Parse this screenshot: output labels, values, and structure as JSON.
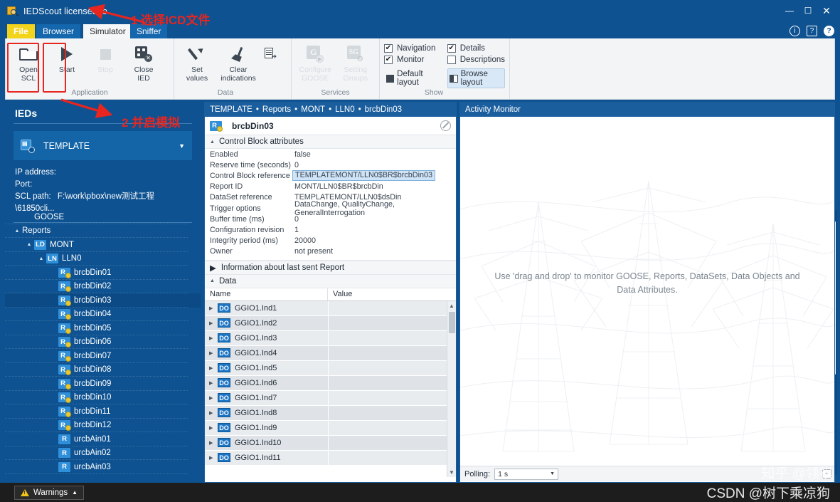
{
  "window": {
    "title": "IEDScout licensed to",
    "app_icon": "magnifier-icon",
    "minimize": "—",
    "maximize": "☐",
    "close": "✕"
  },
  "help_icons": [
    {
      "name": "info-icon",
      "glyph": "i"
    },
    {
      "name": "feedback-icon",
      "glyph": "?"
    },
    {
      "name": "help-icon",
      "glyph": "?"
    }
  ],
  "tabs": [
    {
      "label": "File",
      "name": "tab-file",
      "state": "file"
    },
    {
      "label": "Browser",
      "name": "tab-browser",
      "state": "normal"
    },
    {
      "label": "Simulator",
      "name": "tab-simulator",
      "state": "active"
    },
    {
      "label": "Sniffer",
      "name": "tab-sniffer",
      "state": "normal"
    }
  ],
  "ribbon": {
    "groups": [
      {
        "label": "Application",
        "buttons": [
          {
            "label": "Open\nSCL",
            "icon": "folder-open-icon",
            "disabled": false
          },
          {
            "label": "Start",
            "icon": "play-icon",
            "disabled": false
          },
          {
            "label": "Stop",
            "icon": "stop-icon",
            "disabled": true
          },
          {
            "label": "Close\nIED",
            "icon": "close-ied-icon",
            "disabled": false
          }
        ]
      },
      {
        "label": "Data",
        "buttons": [
          {
            "label": "Set\nvalues",
            "icon": "pencil-icon",
            "disabled": false
          },
          {
            "label": "Clear\nindications",
            "icon": "broom-icon",
            "disabled": false
          },
          {
            "label": "",
            "icon": "report-export-icon",
            "disabled": false
          }
        ]
      },
      {
        "label": "Services",
        "buttons": [
          {
            "label": "Configure\nGOOSE",
            "icon": "goose-config-icon",
            "disabled": true
          },
          {
            "label": "Setting\nGroups",
            "icon": "setting-groups-icon",
            "disabled": true
          }
        ]
      }
    ],
    "show_group": {
      "label": "Show",
      "checkboxes": [
        {
          "label": "Navigation",
          "checked": true
        },
        {
          "label": "Details",
          "checked": true
        },
        {
          "label": "Monitor",
          "checked": true
        },
        {
          "label": "Descriptions",
          "checked": false
        }
      ],
      "layouts": [
        {
          "label": "Default layout",
          "selected": false
        },
        {
          "label": "Browse layout",
          "selected": true
        }
      ]
    }
  },
  "sidebar": {
    "title": "IEDs",
    "ied": {
      "name": "TEMPLATE",
      "icon": "ied-icon",
      "caret": "▼"
    },
    "meta": [
      {
        "key": "IP address:",
        "value": ""
      },
      {
        "key": "Port:",
        "value": ""
      },
      {
        "key": "SCL path:",
        "value": "F:\\work\\pbox\\new测试工程\\61850cli..."
      }
    ],
    "tree": [
      {
        "label": "GOOSE",
        "indent": 1,
        "twist": "",
        "badge": "",
        "selected": false
      },
      {
        "label": "Reports",
        "indent": 0,
        "twist": "▲",
        "badge": "",
        "selected": false
      },
      {
        "label": "MONT",
        "indent": 1,
        "twist": "▲",
        "badge": "LD",
        "selected": false
      },
      {
        "label": "LLN0",
        "indent": 2,
        "twist": "▲",
        "badge": "LN",
        "selected": false
      },
      {
        "label": "brcbDin01",
        "indent": 3,
        "twist": "",
        "badge": "R",
        "badge_dot": true,
        "selected": false
      },
      {
        "label": "brcbDin02",
        "indent": 3,
        "twist": "",
        "badge": "R",
        "badge_dot": true,
        "selected": false
      },
      {
        "label": "brcbDin03",
        "indent": 3,
        "twist": "",
        "badge": "R",
        "badge_dot": true,
        "selected": true
      },
      {
        "label": "brcbDin04",
        "indent": 3,
        "twist": "",
        "badge": "R",
        "badge_dot": true,
        "selected": false
      },
      {
        "label": "brcbDin05",
        "indent": 3,
        "twist": "",
        "badge": "R",
        "badge_dot": true,
        "selected": false
      },
      {
        "label": "brcbDin06",
        "indent": 3,
        "twist": "",
        "badge": "R",
        "badge_dot": true,
        "selected": false
      },
      {
        "label": "brcbDin07",
        "indent": 3,
        "twist": "",
        "badge": "R",
        "badge_dot": true,
        "selected": false
      },
      {
        "label": "brcbDin08",
        "indent": 3,
        "twist": "",
        "badge": "R",
        "badge_dot": true,
        "selected": false
      },
      {
        "label": "brcbDin09",
        "indent": 3,
        "twist": "",
        "badge": "R",
        "badge_dot": true,
        "selected": false
      },
      {
        "label": "brcbDin10",
        "indent": 3,
        "twist": "",
        "badge": "R",
        "badge_dot": true,
        "selected": false
      },
      {
        "label": "brcbDin11",
        "indent": 3,
        "twist": "",
        "badge": "R",
        "badge_dot": true,
        "selected": false
      },
      {
        "label": "brcbDin12",
        "indent": 3,
        "twist": "",
        "badge": "R",
        "badge_dot": true,
        "selected": false
      },
      {
        "label": "urcbAin01",
        "indent": 3,
        "twist": "",
        "badge": "R",
        "badge_dot": false,
        "selected": false
      },
      {
        "label": "urcbAin02",
        "indent": 3,
        "twist": "",
        "badge": "R",
        "badge_dot": false,
        "selected": false
      },
      {
        "label": "urcbAin03",
        "indent": 3,
        "twist": "",
        "badge": "R",
        "badge_dot": false,
        "selected": false
      }
    ],
    "scroll_up": "▲",
    "scroll_down": "▼"
  },
  "details": {
    "breadcrumb": [
      "TEMPLATE",
      "Reports",
      "MONT",
      "LLN0",
      "brcbDin03"
    ],
    "breadcrumb_sep": "•",
    "card_name": "brcbDin03",
    "card_icon": "report-control-block-icon",
    "disable_icon": "no-entry-icon",
    "section_attrs_title": "Control Block attributes",
    "section_attrs_twist": "▲",
    "attributes": [
      {
        "key": "Enabled",
        "value": "false",
        "highlight": false
      },
      {
        "key": "Reserve time (seconds)",
        "value": "0",
        "highlight": false
      },
      {
        "key": "Control Block reference",
        "value": "TEMPLATEMONT/LLN0$BR$brcbDin03",
        "highlight": true
      },
      {
        "key": "Report ID",
        "value": "MONT/LLN0$BR$brcbDin",
        "highlight": false
      },
      {
        "key": "DataSet reference",
        "value": "TEMPLATEMONT/LLN0$dsDin",
        "highlight": false
      },
      {
        "key": "Trigger options",
        "value": "DataChange, QualityChange, GeneralInterrogation",
        "highlight": false
      },
      {
        "key": "Buffer time (ms)",
        "value": "0",
        "highlight": false
      },
      {
        "key": "Configuration revision",
        "value": "1",
        "highlight": false
      },
      {
        "key": "Integrity period (ms)",
        "value": "20000",
        "highlight": false
      },
      {
        "key": "Owner",
        "value": "not present",
        "highlight": false
      }
    ],
    "section_lastreport_title": "Information about last sent Report",
    "section_lastreport_twist": "▶",
    "section_data_title": "Data",
    "section_data_twist": "▲",
    "grid_headers": [
      "Name",
      "Value"
    ],
    "rows": [
      {
        "twist": "▶",
        "badge": "DO",
        "name": "GGIO1.Ind1",
        "value": ""
      },
      {
        "twist": "▶",
        "badge": "DO",
        "name": "GGIO1.Ind2",
        "value": ""
      },
      {
        "twist": "▶",
        "badge": "DO",
        "name": "GGIO1.Ind3",
        "value": ""
      },
      {
        "twist": "▶",
        "badge": "DO",
        "name": "GGIO1.Ind4",
        "value": ""
      },
      {
        "twist": "▶",
        "badge": "DO",
        "name": "GGIO1.Ind5",
        "value": ""
      },
      {
        "twist": "▶",
        "badge": "DO",
        "name": "GGIO1.Ind6",
        "value": ""
      },
      {
        "twist": "▶",
        "badge": "DO",
        "name": "GGIO1.Ind7",
        "value": ""
      },
      {
        "twist": "▶",
        "badge": "DO",
        "name": "GGIO1.Ind8",
        "value": ""
      },
      {
        "twist": "▶",
        "badge": "DO",
        "name": "GGIO1.Ind9",
        "value": ""
      },
      {
        "twist": "▶",
        "badge": "DO",
        "name": "GGIO1.Ind10",
        "value": ""
      },
      {
        "twist": "▶",
        "badge": "DO",
        "name": "GGIO1.Ind11",
        "value": ""
      }
    ],
    "scroll_up": "▲",
    "scroll_down": "▼"
  },
  "monitor": {
    "title": "Activity Monitor",
    "hint": "Use 'drag and drop' to monitor GOOSE, Reports, DataSets, Data Objects and Data Attributes.",
    "polling_label": "Polling:",
    "polling_value": "1 s",
    "polling_caret": "▼",
    "add_button": "+"
  },
  "status": {
    "warnings_label": "Warnings",
    "warnings_icon": "warning-triangle-icon",
    "warnings_caret": "▲"
  },
  "annotations": [
    {
      "text": "1 选择ICD文件",
      "name": "annotation-step-1"
    },
    {
      "text": "2 并启模拟",
      "name": "annotation-step-2"
    }
  ],
  "watermarks": [
    {
      "text": "知乎 @领祺",
      "name": "watermark-zhihu"
    },
    {
      "text": "CSDN @树下乘凉狗",
      "name": "watermark-csdn"
    }
  ],
  "colors": {
    "chrome_blue": "#0e5291",
    "panel_header_blue": "#1b5e9e",
    "accent_yellow": "#f3d41c",
    "annotation_red": "#e8251f",
    "selection_blue": "#cfe4f7",
    "badge_blue": "#2f8fd8"
  }
}
